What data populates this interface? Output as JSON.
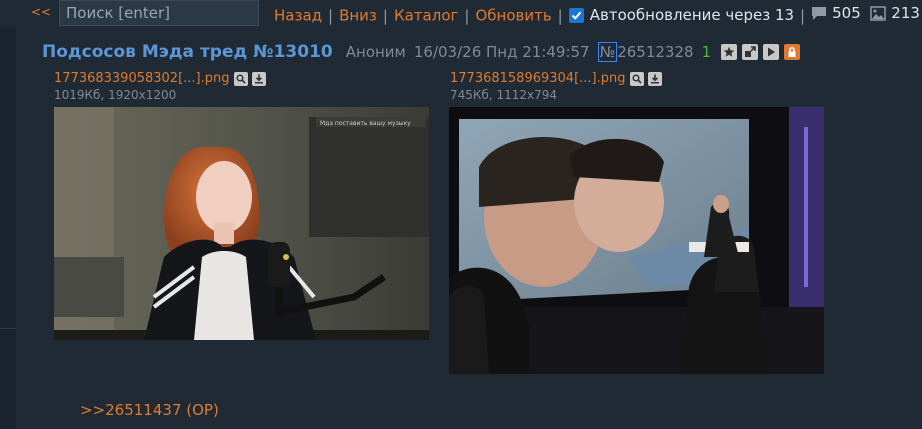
{
  "topbar": {
    "back": "<<",
    "search_placeholder": "Поиск [enter]",
    "nav": [
      "Назад",
      "Вниз",
      "Каталог",
      "Обновить"
    ],
    "auto_update": "Автообновление через 13",
    "posts_count": "505",
    "images_count": "213"
  },
  "post": {
    "title": "Подсосов Мэда тред №13010",
    "author": "Аноним",
    "datetime": "16/03/26 Пнд 21:49:57",
    "num_sign": "№",
    "number": "26512328",
    "replies": "1"
  },
  "files": [
    {
      "name": "177368339058302[...].png",
      "info": "1019Кб, 1920x1200",
      "overlay": "Мда  поставить вашу музыку"
    },
    {
      "name": "177368158969304[...].png",
      "info": "745Кб, 1112x794"
    }
  ],
  "reply_link": ">>26511437 (OP)",
  "colors": {
    "accent": "#e07a2e",
    "title": "#5c96d6",
    "bg": "#1f2a35",
    "reply_count": "#4fb43d"
  }
}
